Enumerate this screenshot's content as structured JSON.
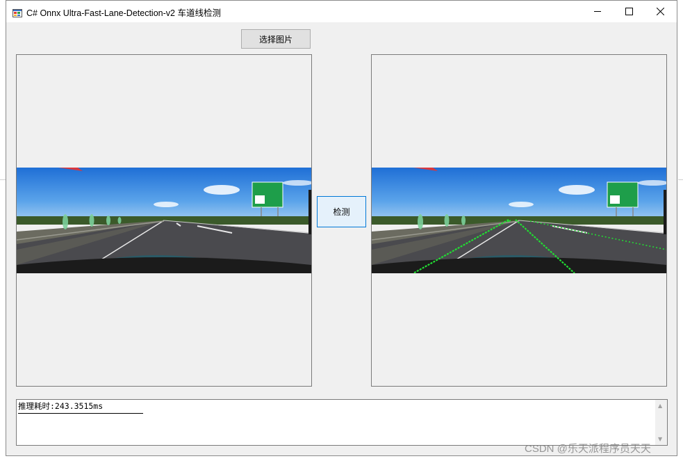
{
  "window": {
    "title": "C# Onnx Ultra-Fast-Lane-Detection-v2 车道线检测"
  },
  "buttons": {
    "select_image": "选择图片",
    "detect": "检测"
  },
  "output": {
    "text": "推理耗时:243.3515ms"
  },
  "watermark": "CSDN @乐天派程序员天天",
  "icons": {
    "app": "app-icon",
    "minimize": "minimize-icon",
    "maximize": "maximize-icon",
    "close": "close-icon",
    "scroll_up": "scroll-up-icon",
    "scroll_down": "scroll-down-icon"
  },
  "colors": {
    "lane_line": "#22dd33",
    "detect_button_border": "#0078d7",
    "sign_green": "#1e9e4a"
  }
}
